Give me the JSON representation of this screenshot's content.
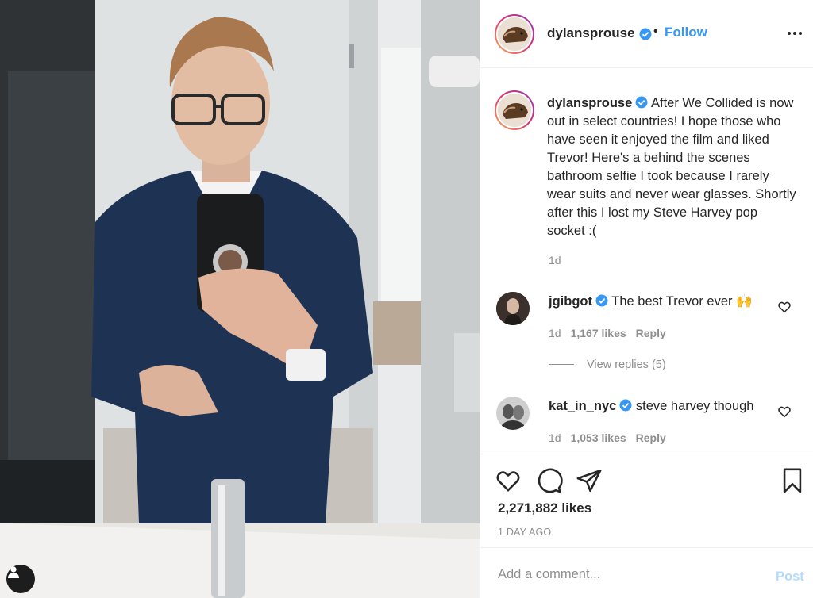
{
  "post": {
    "username": "dylansprouse",
    "follow_label": "Follow",
    "separator": "•",
    "caption": "After We Collided is now out in select countries! I hope those who have seen it enjoyed the film and liked Trevor! Here's a behind the scenes bathroom selfie I took because I rarely wear suits and never wear glasses. Shortly after this I lost my Steve Harvey pop socket :(",
    "caption_time": "1d",
    "likes": "2,271,882 likes",
    "time_ago": "1 DAY AGO"
  },
  "comments": [
    {
      "username": "jgibgot",
      "text": "The best Trevor ever 🙌",
      "time": "1d",
      "likes": "1,167 likes",
      "reply_label": "Reply",
      "view_replies": "View replies (5)"
    },
    {
      "username": "kat_in_nyc",
      "text": "steve harvey though",
      "time": "1d",
      "likes": "1,053 likes",
      "reply_label": "Reply"
    }
  ],
  "add_comment": {
    "placeholder": "Add a comment...",
    "post_label": "Post"
  },
  "icons": {
    "verified": "verified-badge-icon",
    "more": "more-options-icon",
    "like": "heart-icon",
    "comment": "comment-icon",
    "share": "paper-plane-icon",
    "save": "bookmark-icon",
    "tag": "user-tag-icon"
  },
  "colors": {
    "accent": "#3897f0",
    "text": "#262626",
    "muted": "#8e8e8e",
    "border": "#efefef",
    "post_disabled": "#b3dbff"
  }
}
